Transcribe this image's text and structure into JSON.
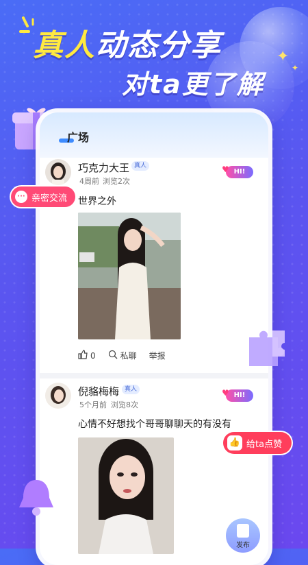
{
  "promo": {
    "headline_line1_a": "真人",
    "headline_line1_b": "动态分享",
    "headline_line2": "对ta更了解"
  },
  "page": {
    "tab_title": "广场"
  },
  "floating": {
    "chat_tag": "亲密交流",
    "like_tag": "给ta点赞",
    "publish_label": "发布"
  },
  "posts": [
    {
      "username": "巧克力大王",
      "badge": "真人",
      "time": "4周前",
      "views": "浏览2次",
      "hi": "HI!",
      "text": "世界之外",
      "likes": "0",
      "chat": "私聊",
      "report": "举报"
    },
    {
      "username": "倪貉梅梅",
      "badge": "真人",
      "time": "5个月前",
      "views": "浏览8次",
      "hi": "HI!",
      "text": "心情不好想找个哥哥聊聊天的有没有"
    }
  ],
  "colors": {
    "background": "#5a55f0",
    "accent_yellow": "#ffe940",
    "chat_tag": "#ff4a76",
    "like_tag": "#ff3e5c",
    "tab_underline": "#3d8bff"
  },
  "icons": [
    "sparkle-icon",
    "gift-icon",
    "chat-bubble-icon",
    "thumbs-up-icon",
    "search-chat-icon",
    "puzzle-icon",
    "bell-icon",
    "edit-icon"
  ]
}
